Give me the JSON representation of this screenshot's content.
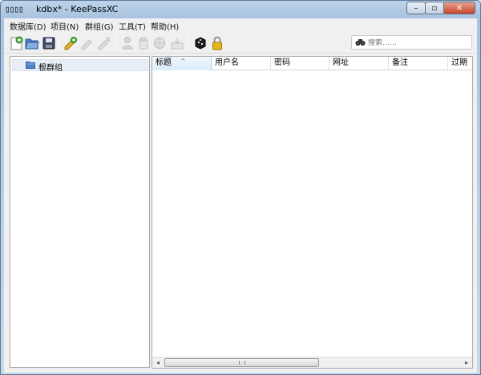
{
  "window": {
    "title_glyphs": "▯▯▯▯",
    "title": "kdbx* - KeePassXC",
    "buttons": {
      "minimize": "–",
      "maximize": "▫",
      "close": "✕"
    }
  },
  "menu": [
    {
      "label": "数据库(D)"
    },
    {
      "label": "项目(N)"
    },
    {
      "label": "群组(G)"
    },
    {
      "label": "工具(T)"
    },
    {
      "label": "帮助(H)"
    }
  ],
  "toolbar": {
    "icons": [
      "new-database-icon",
      "open-database-icon",
      "save-database-icon",
      "add-entry-icon",
      "edit-entry-icon",
      "delete-entry-icon",
      "copy-username-icon",
      "copy-password-icon",
      "open-url-icon",
      "autotype-icon",
      "password-generator-icon",
      "lock-database-icon"
    ]
  },
  "search": {
    "placeholder": "搜索……"
  },
  "groups": {
    "root_label": "根群组"
  },
  "entries": {
    "columns": [
      "标题",
      "用户名",
      "密码",
      "网址",
      "备注",
      "过期"
    ],
    "sorted_column": "标题",
    "rows": []
  },
  "colors": {
    "selection": "#e8eef6",
    "header_sorted": "#dcecf8",
    "title_bar": "#bcd3ea"
  }
}
